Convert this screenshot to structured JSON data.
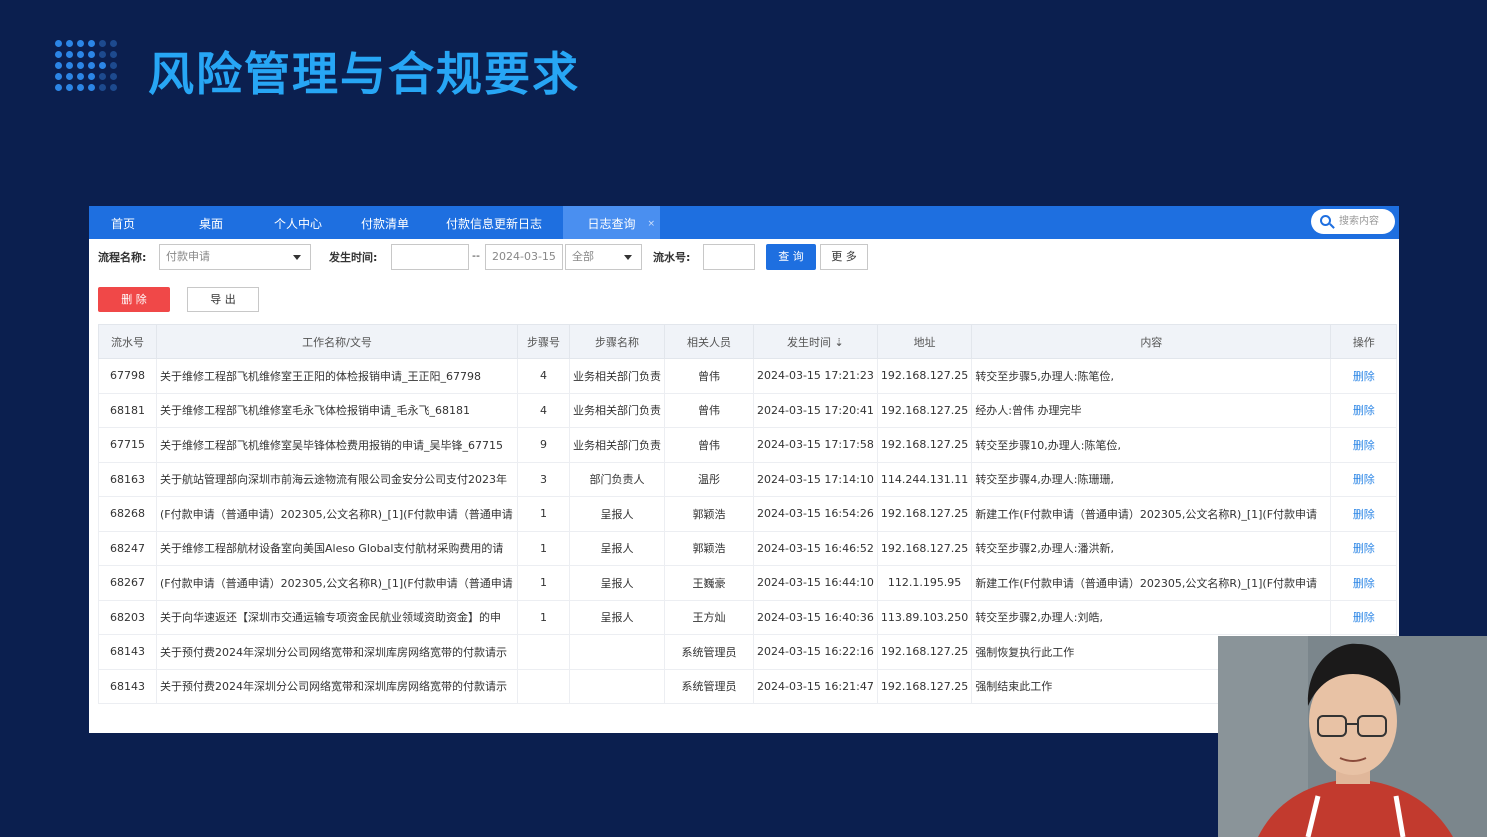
{
  "slide": {
    "title": "风险管理与合规要求"
  },
  "tabs": [
    {
      "label": "首页",
      "active": false
    },
    {
      "label": "桌面",
      "active": false
    },
    {
      "label": "个人中心",
      "active": false
    },
    {
      "label": "付款清单",
      "active": false
    },
    {
      "label": "付款信息更新日志",
      "active": false
    },
    {
      "label": "日志查询",
      "active": true
    }
  ],
  "search": {
    "placeholder": "搜索内容"
  },
  "filters": {
    "flow_name_label": "流程名称:",
    "flow_name_value": "付款申请",
    "time_label": "发生时间:",
    "time_start": "",
    "time_sep": "--",
    "time_end": "2024-03-15",
    "range_value": "全部",
    "serial_label": "流水号:",
    "serial_value": "",
    "query_label": "查 询",
    "more_label": "更 多"
  },
  "actions": {
    "delete_label": "删 除",
    "export_label": "导 出"
  },
  "table": {
    "headers": [
      "流水号",
      "工作名称/文号",
      "步骤号",
      "步骤名称",
      "相关人员",
      "发生时间 ⇣",
      "地址",
      "内容",
      "操作"
    ],
    "rows": [
      [
        "67798",
        "关于维修工程部飞机维修室王正阳的体检报销申请_王正阳_67798",
        "4",
        "业务相关部门负责",
        "曾伟",
        "2024-03-15 17:21:23",
        "192.168.127.25",
        "转交至步骤5,办理人:陈笔俭,",
        "删除"
      ],
      [
        "68181",
        "关于维修工程部飞机维修室毛永飞体检报销申请_毛永飞_68181",
        "4",
        "业务相关部门负责",
        "曾伟",
        "2024-03-15 17:20:41",
        "192.168.127.25",
        "经办人:曾伟 办理完毕",
        "删除"
      ],
      [
        "67715",
        "关于维修工程部飞机维修室吴毕锋体检费用报销的申请_吴毕锋_67715",
        "9",
        "业务相关部门负责",
        "曾伟",
        "2024-03-15 17:17:58",
        "192.168.127.25",
        "转交至步骤10,办理人:陈笔俭,",
        "删除"
      ],
      [
        "68163",
        "关于航站管理部向深圳市前海云途物流有限公司金安分公司支付2023年",
        "3",
        "部门负责人",
        "温彤",
        "2024-03-15 17:14:10",
        "114.244.131.11",
        "转交至步骤4,办理人:陈珊珊,",
        "删除"
      ],
      [
        "68268",
        "(F付款申请（普通申请）202305,公文名称R)_[1](F付款申请（普通申请",
        "1",
        "呈报人",
        "郭颖浩",
        "2024-03-15 16:54:26",
        "192.168.127.25",
        "新建工作(F付款申请（普通申请）202305,公文名称R)_[1](F付款申请",
        "删除"
      ],
      [
        "68247",
        "关于维修工程部航材设备室向美国Aleso Global支付航材采购费用的请",
        "1",
        "呈报人",
        "郭颖浩",
        "2024-03-15 16:46:52",
        "192.168.127.25",
        "转交至步骤2,办理人:潘洪新,",
        "删除"
      ],
      [
        "68267",
        "(F付款申请（普通申请）202305,公文名称R)_[1](F付款申请（普通申请",
        "1",
        "呈报人",
        "王巍豪",
        "2024-03-15 16:44:10",
        "112.1.195.95",
        "新建工作(F付款申请（普通申请）202305,公文名称R)_[1](F付款申请",
        "删除"
      ],
      [
        "68203",
        "关于向华速返还【深圳市交通运输专项资金民航业领域资助资金】的申",
        "1",
        "呈报人",
        "王方灿",
        "2024-03-15 16:40:36",
        "113.89.103.250",
        "转交至步骤2,办理人:刘皓,",
        "删除"
      ],
      [
        "68143",
        "关于预付费2024年深圳分公司网络宽带和深圳库房网络宽带的付款请示",
        "",
        "",
        "系统管理员",
        "2024-03-15 16:22:16",
        "192.168.127.25",
        "强制恢复执行此工作",
        ""
      ],
      [
        "68143",
        "关于预付费2024年深圳分公司网络宽带和深圳库房网络宽带的付款请示",
        "",
        "",
        "系统管理员",
        "2024-03-15 16:21:47",
        "192.168.127.25",
        "强制结束此工作",
        ""
      ]
    ]
  }
}
